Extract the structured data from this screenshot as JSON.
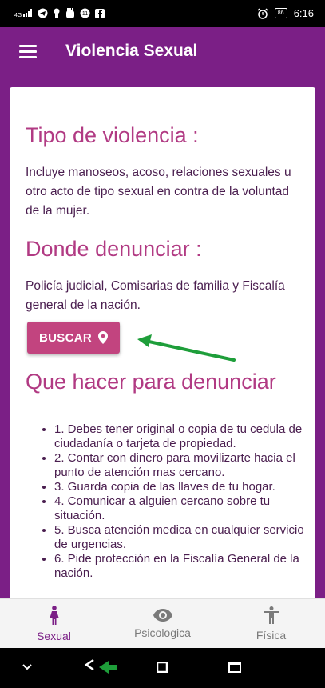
{
  "status_bar": {
    "time": "6:16",
    "battery": "86",
    "signal_label": "4G"
  },
  "app_bar": {
    "title": "Violencia Sexual"
  },
  "content": {
    "tipo_title": "Tipo de violencia :",
    "tipo_text": "Incluye manoseos, acoso, relaciones sexuales u otro acto de tipo sexual en contra de la voluntad de la mujer.",
    "donde_title": "Donde denunciar :",
    "donde_text": "Policía judicial, Comisarias de familia y Fiscalía general de la nación.",
    "buscar_label": "BUSCAR",
    "que_hacer_title": "Que hacer para denunciar",
    "steps": [
      "1. Debes tener original o copia de tu cedula de ciudadanía o tarjeta de propiedad.",
      "2. Contar con dinero para movilizarte hacia el punto de atención mas cercano.",
      "3. Guarda copia de las llaves de tu hogar.",
      "4. Comunicar a alguien cercano sobre tu situación.",
      "5. Busca atención medica en cualquier servicio de urgencias.",
      "6. Pide protección en la Fiscalía General de la nación."
    ]
  },
  "bottom_nav": {
    "items": [
      {
        "label": "Sexual",
        "icon": "woman-icon",
        "active": true
      },
      {
        "label": "Psicologica",
        "icon": "eye-icon",
        "active": false
      },
      {
        "label": "Física",
        "icon": "person-icon",
        "active": false
      }
    ]
  },
  "colors": {
    "primary": "#7b1f86",
    "accent": "#c2447f",
    "title_text": "#b13a83",
    "body_text": "#4a1e4f",
    "annotation_arrow": "#1e9e3a"
  }
}
